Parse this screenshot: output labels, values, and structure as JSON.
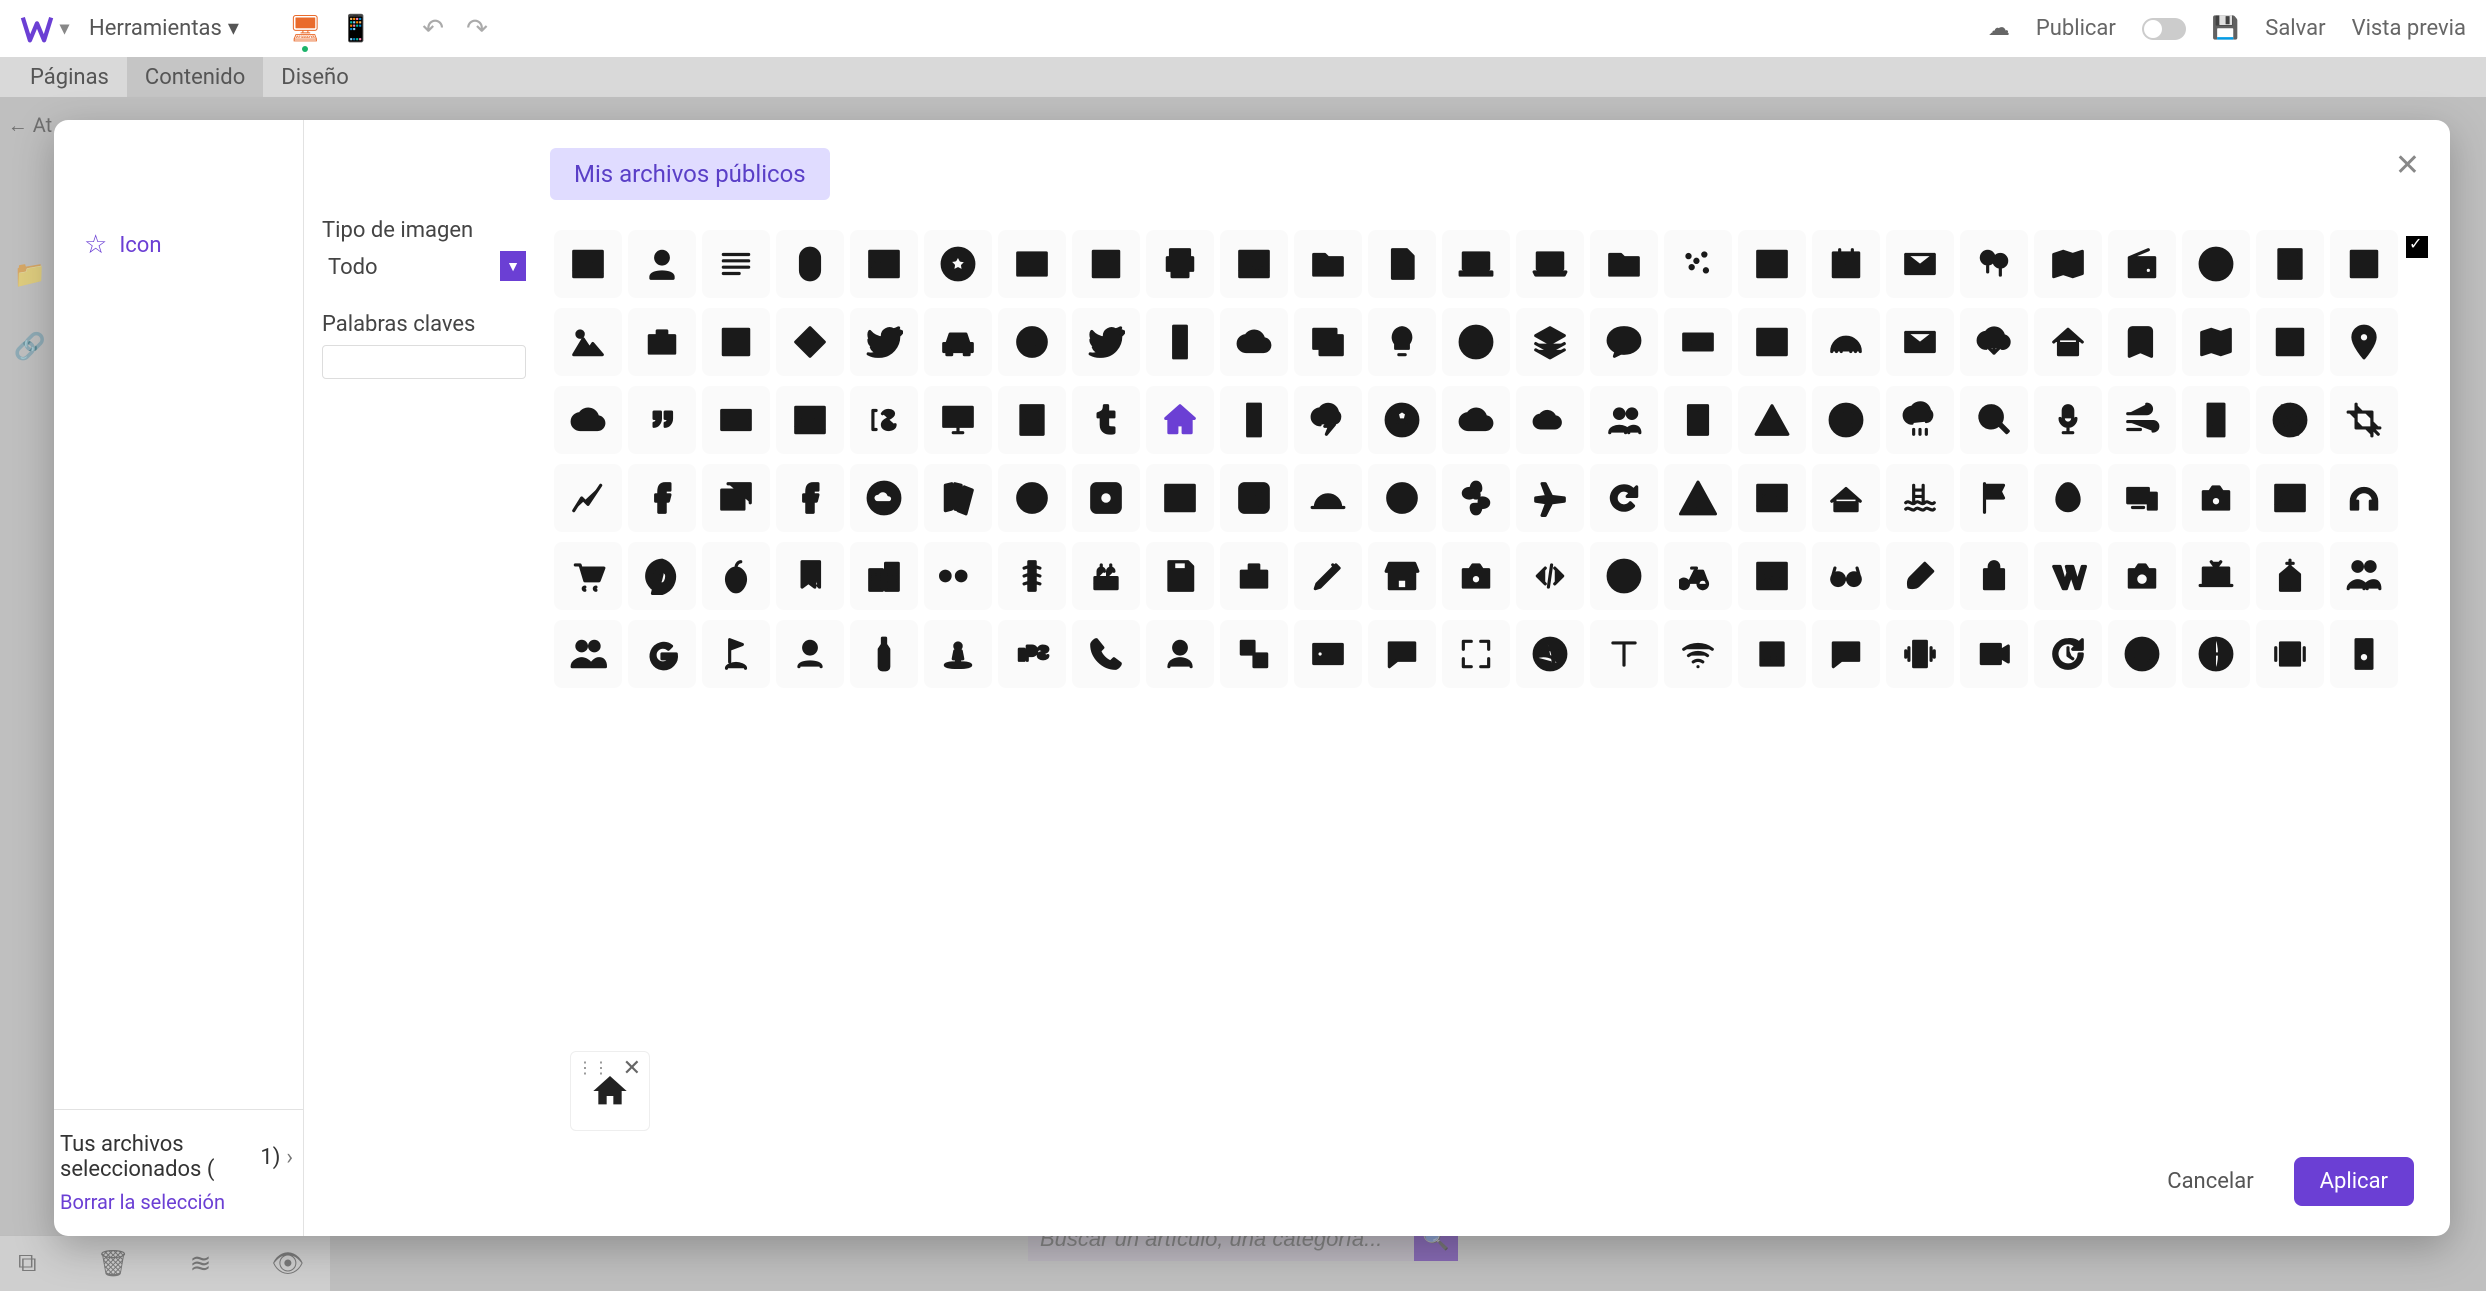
{
  "topbar": {
    "tools": "Herramientas",
    "publish": "Publicar",
    "save": "Salvar",
    "preview": "Vista previa"
  },
  "tabs": {
    "pages": "Páginas",
    "content": "Contenido",
    "design": "Diseño"
  },
  "leftPanel": {
    "back": "At",
    "icon_label": "Icon"
  },
  "modal": {
    "source_tab": "Mis archivos públicos",
    "filters": {
      "type_label": "Tipo de imagen",
      "type_value": "Todo",
      "keywords_label": "Palabras claves"
    },
    "selected": {
      "title": "Tus archivos seleccionados (",
      "count": "1)",
      "clear": "Borrar la selección"
    },
    "cancel": "Cancelar",
    "apply": "Aplicar"
  },
  "bg_search_placeholder": "Buscar un artículo, una categoría...",
  "icons": [
    [
      "image",
      "person",
      "text-lines",
      "mouse",
      "picture-stars",
      "star-circle",
      "hq",
      "image-frame",
      "printer",
      "picture",
      "folder",
      "file-text",
      "laptop",
      "laptop-alt",
      "folder-solid",
      "scatter",
      "window",
      "calendar-range",
      "mail",
      "balloons",
      "map-fold",
      "radio",
      "info-circle",
      "building",
      "grid"
    ],
    [
      "mountains",
      "briefcase",
      "grid4",
      "tag-more",
      "twitter",
      "car",
      "face",
      "twitter-outline",
      "phone",
      "cloud",
      "picture-overlay",
      "bulb",
      "copyright",
      "layers",
      "line-app",
      "keyboard",
      "window-grid",
      "rainbow",
      "mail-alt",
      "cloud-download",
      "house-roof",
      "book",
      "map",
      "image-frame-alt",
      "pin"
    ],
    [
      "cloud-outline",
      "quote",
      "card",
      "image-solid",
      "is",
      "monitor",
      "film",
      "tumblr",
      "home",
      "phone-alt",
      "cloud-bolt",
      "soccer",
      "cloud-solid",
      "cloud-flat",
      "group",
      "building-alt",
      "warning-triangle",
      "g-circle",
      "cloud-rain",
      "search",
      "mic",
      "wind",
      "fridge",
      "aperture",
      "crop"
    ],
    [
      "chart-line",
      "facebook-light",
      "image-stack",
      "facebook",
      "cloud-circle",
      "books",
      "smile",
      "instagram",
      "month-grid",
      "instagram-alt",
      "dome",
      "circle",
      "flower",
      "plane",
      "refresh",
      "warning-solid",
      "picture-mountains",
      "roof",
      "pool",
      "flag",
      "egg",
      "devices",
      "camera",
      "image-add",
      "headphones"
    ],
    [
      "cart",
      "pinterest",
      "apple",
      "bookmarks",
      "buildings",
      "flickr",
      "traffic",
      "cake",
      "save",
      "briefcase-open",
      "pen",
      "storefront",
      "camera-outline",
      "code",
      "error",
      "bicycle",
      "picture-frame",
      "glasses",
      "brush",
      "bag",
      "wikipedia",
      "camera-solid",
      "tv",
      "church",
      "people"
    ],
    [
      "group-solid",
      "google",
      "golf",
      "person-outline",
      "bottle",
      "street-view",
      "gps",
      "phone-handset",
      "user",
      "checker",
      "id-card",
      "chat",
      "fullscreen",
      "dribbble",
      "text-t",
      "wifi",
      "music",
      "sms",
      "vibrate",
      "video-add",
      "history",
      "smiley",
      "globe",
      "carousel",
      "speaker"
    ]
  ]
}
